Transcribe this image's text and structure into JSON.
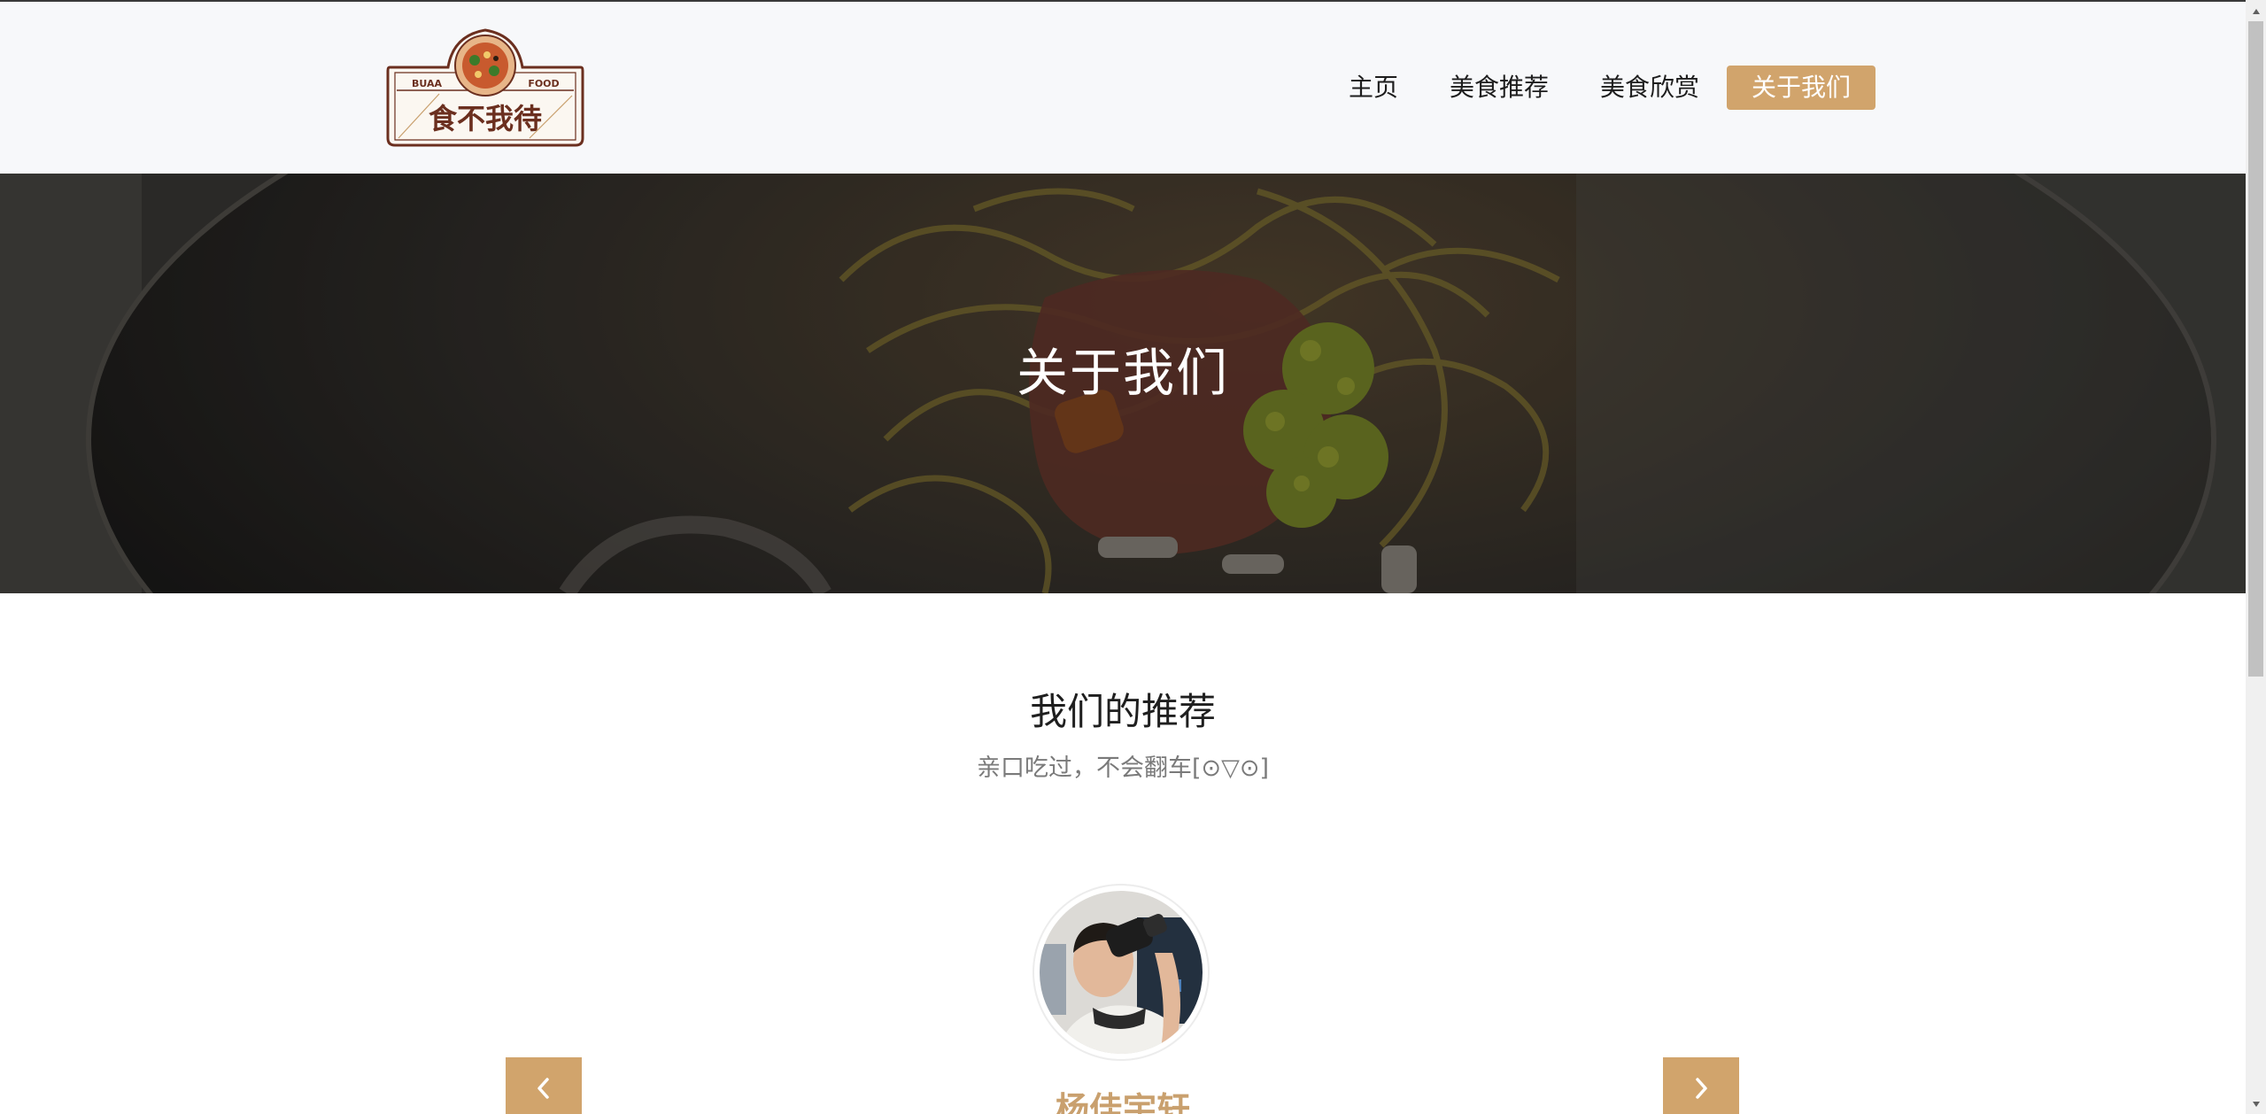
{
  "header": {
    "logo": {
      "left_text": "BUAA",
      "right_text": "FOOD",
      "name": "食不我待"
    },
    "nav": [
      {
        "label": "主页",
        "active": false
      },
      {
        "label": "美食推荐",
        "active": false
      },
      {
        "label": "美食欣赏",
        "active": false
      },
      {
        "label": "关于我们",
        "active": true
      }
    ]
  },
  "hero": {
    "title": "关于我们"
  },
  "section": {
    "title": "我们的推荐",
    "subtitle": "亲口吃过，不会翻车[⊙▽⊙]"
  },
  "carousel": {
    "person_name": "杨佳宇轩",
    "prev_icon": "chevron-left-icon",
    "next_icon": "chevron-right-icon"
  },
  "colors": {
    "accent": "#d1a46c",
    "header_bg": "#f7f8fa",
    "name_color": "#c9a06e",
    "logo_brown": "#6b2f1f"
  }
}
